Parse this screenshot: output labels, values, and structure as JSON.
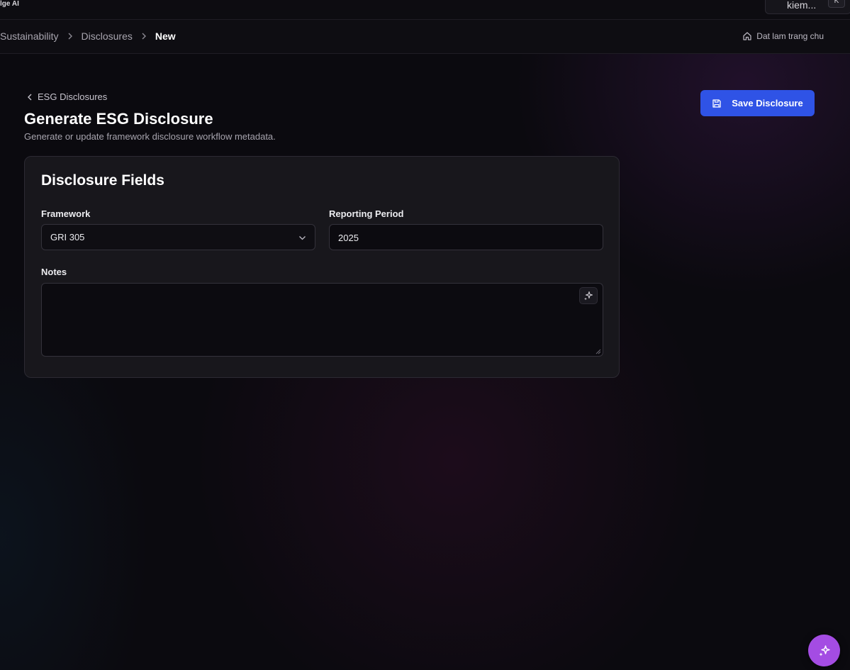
{
  "topbar": {
    "brand": "lge AI",
    "search_text": "kiem...",
    "shortcut": "K"
  },
  "breadcrumb": {
    "items": [
      "Sustainability",
      "Disclosures"
    ],
    "current": "New",
    "home_label": "Dat lam trang chu"
  },
  "header": {
    "back_label": "ESG Disclosures",
    "title": "Generate ESG Disclosure",
    "subtitle": "Generate or update framework disclosure workflow metadata.",
    "save_label": "Save Disclosure"
  },
  "form": {
    "card_title": "Disclosure Fields",
    "framework_label": "Framework",
    "framework_value": "GRI 305",
    "period_label": "Reporting Period",
    "period_value": "2025",
    "notes_label": "Notes",
    "notes_value": ""
  },
  "colors": {
    "accent": "#2f53e6",
    "fab": "#a44ce3",
    "background": "#0b0a0f",
    "card": "#18171c"
  },
  "icons": {
    "home": "home-icon",
    "save": "save-icon",
    "ai": "sparkles-icon",
    "chevron": "chevron-down-icon"
  }
}
